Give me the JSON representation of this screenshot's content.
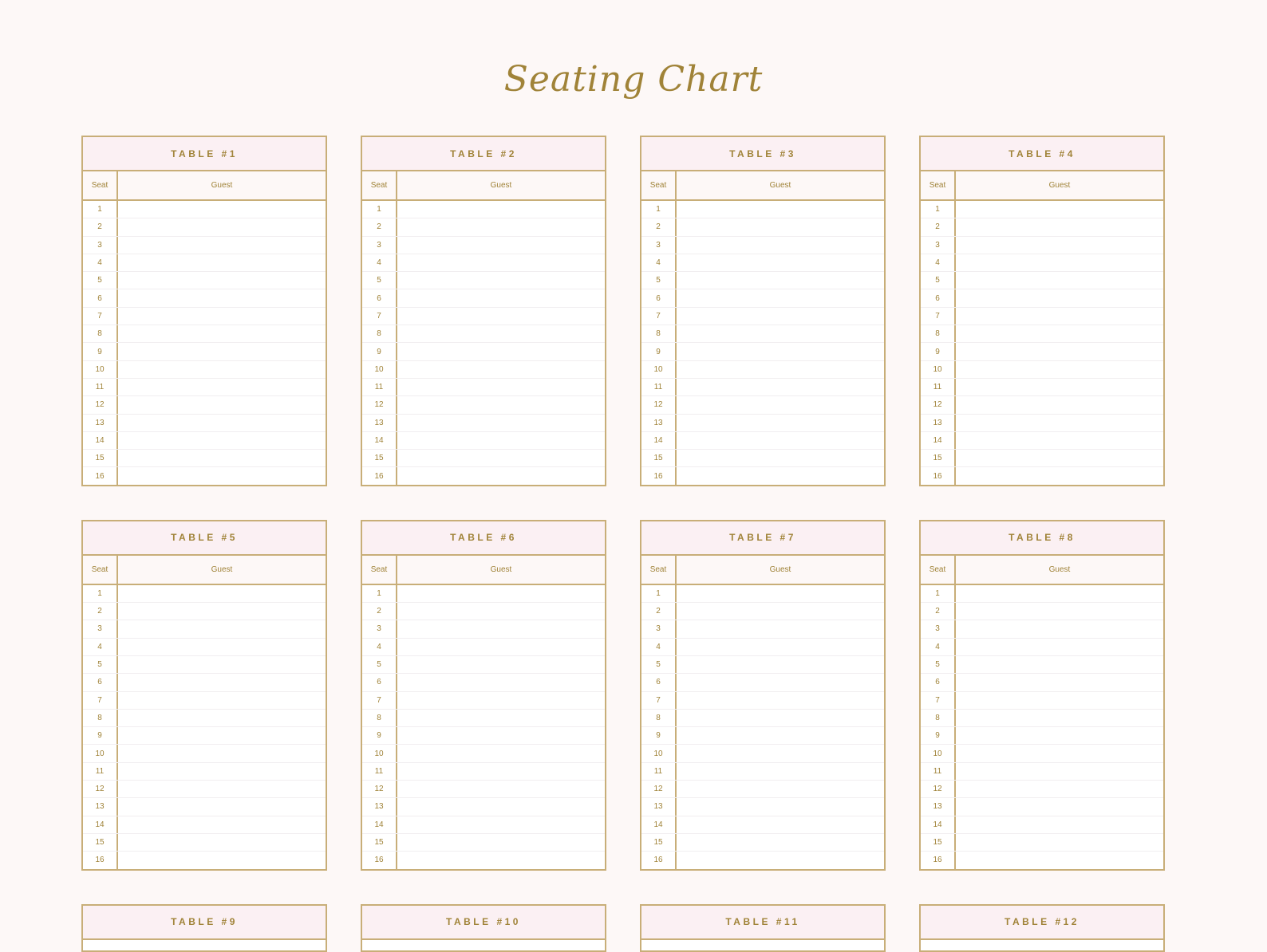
{
  "page": {
    "title": "Seating Chart",
    "colors": {
      "accent": "#a08338",
      "border": "#c8ae78",
      "header_bg": "#fbf0f3",
      "background": "#fdf8f7"
    },
    "column_headers": {
      "seat": "Seat",
      "guest": "Guest"
    },
    "seats": [
      "1",
      "2",
      "3",
      "4",
      "5",
      "6",
      "7",
      "8",
      "9",
      "10",
      "11",
      "12",
      "13",
      "14",
      "15",
      "16"
    ],
    "tables": [
      {
        "label": "TABLE #1",
        "guests": [
          "",
          "",
          "",
          "",
          "",
          "",
          "",
          "",
          "",
          "",
          "",
          "",
          "",
          "",
          "",
          ""
        ]
      },
      {
        "label": "TABLE #2",
        "guests": [
          "",
          "",
          "",
          "",
          "",
          "",
          "",
          "",
          "",
          "",
          "",
          "",
          "",
          "",
          "",
          ""
        ]
      },
      {
        "label": "TABLE #3",
        "guests": [
          "",
          "",
          "",
          "",
          "",
          "",
          "",
          "",
          "",
          "",
          "",
          "",
          "",
          "",
          "",
          ""
        ]
      },
      {
        "label": "TABLE #4",
        "guests": [
          "",
          "",
          "",
          "",
          "",
          "",
          "",
          "",
          "",
          "",
          "",
          "",
          "",
          "",
          "",
          ""
        ]
      },
      {
        "label": "TABLE #5",
        "guests": [
          "",
          "",
          "",
          "",
          "",
          "",
          "",
          "",
          "",
          "",
          "",
          "",
          "",
          "",
          "",
          ""
        ]
      },
      {
        "label": "TABLE #6",
        "guests": [
          "",
          "",
          "",
          "",
          "",
          "",
          "",
          "",
          "",
          "",
          "",
          "",
          "",
          "",
          "",
          ""
        ]
      },
      {
        "label": "TABLE #7",
        "guests": [
          "",
          "",
          "",
          "",
          "",
          "",
          "",
          "",
          "",
          "",
          "",
          "",
          "",
          "",
          "",
          ""
        ]
      },
      {
        "label": "TABLE #8",
        "guests": [
          "",
          "",
          "",
          "",
          "",
          "",
          "",
          "",
          "",
          "",
          "",
          "",
          "",
          "",
          "",
          ""
        ]
      },
      {
        "label": "TABLE #9"
      },
      {
        "label": "TABLE #10"
      },
      {
        "label": "TABLE #11"
      },
      {
        "label": "TABLE #12"
      }
    ]
  }
}
